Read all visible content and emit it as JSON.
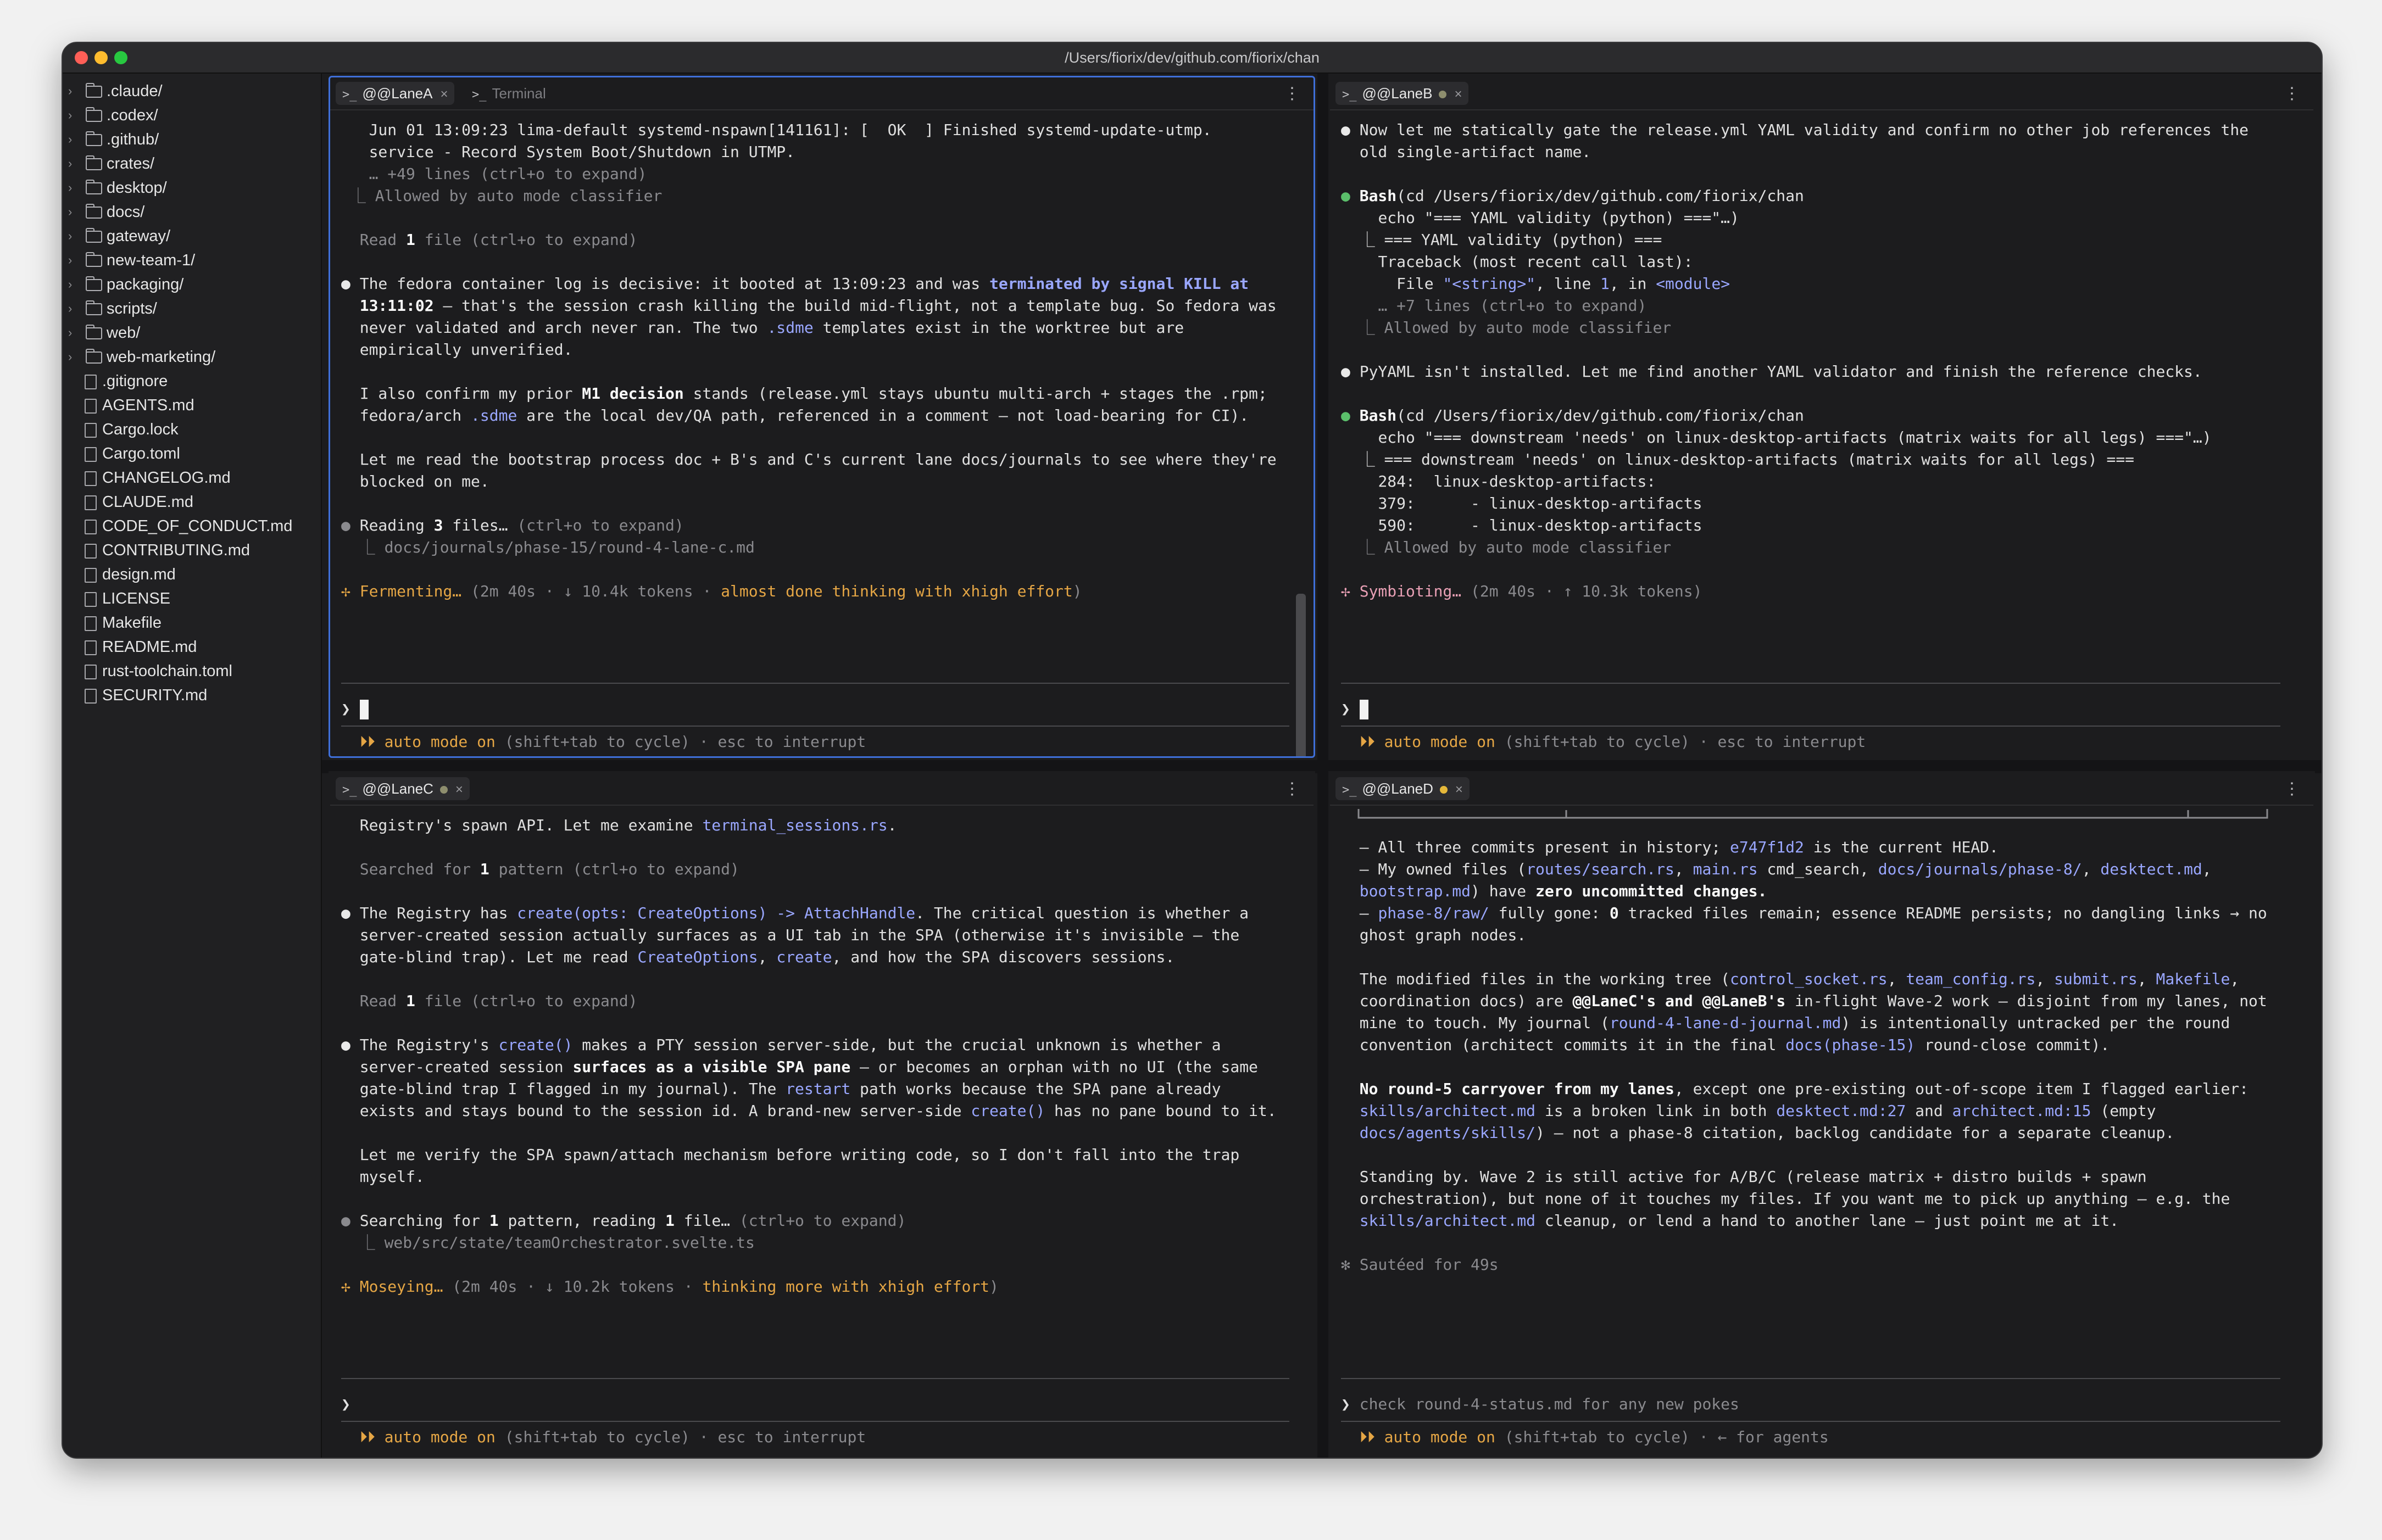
{
  "window": {
    "title": "/Users/fiorix/dev/github.com/fiorix/chan"
  },
  "sidebar": {
    "folders": [
      ".claude/",
      ".codex/",
      ".github/",
      "crates/",
      "desktop/",
      "docs/",
      "gateway/",
      "new-team-1/",
      "packaging/",
      "scripts/",
      "web/",
      "web-marketing/"
    ],
    "files": [
      ".gitignore",
      "AGENTS.md",
      "Cargo.lock",
      "Cargo.toml",
      "CHANGELOG.md",
      "CLAUDE.md",
      "CODE_OF_CONDUCT.md",
      "CONTRIBUTING.md",
      "design.md",
      "LICENSE",
      "Makefile",
      "README.md",
      "rust-toolchain.toml",
      "SECURITY.md"
    ]
  },
  "panes": {
    "top_left": {
      "tabs": [
        {
          "label": "@@LaneA",
          "close": "×"
        },
        {
          "label": "Terminal"
        }
      ],
      "lines": {
        "l1": "Jun 01 13:09:23 lima-default systemd-nspawn[141161]: [  OK  ] Finished systemd-update-utmp.",
        "l2": "service - Record System Boot/Shutdown in UTMP.",
        "l3": "… +49 lines (ctrl+o to expand)",
        "l4": "Allowed by auto mode classifier",
        "l5a": "Read ",
        "l5b": "1",
        "l5c": " file (ctrl+o to expand)",
        "p1a": "The fedora container log is decisive: it booted at 13:09:23 and was ",
        "p1b": "terminated by signal KILL at",
        "p1c": "13:11:02",
        "p1d": " — that's the session crash killing the build mid-flight, not a template bug. So fedora was",
        "p1e": "never validated and arch never ran. The two ",
        "p1f": ".sdme",
        "p1g": " templates exist in the worktree but are",
        "p1h": "empirically unverified.",
        "p2a": "I also confirm my prior ",
        "p2b": "M1 decision",
        "p2c": " stands (release.yml stays ubuntu multi-arch + stages the .rpm;",
        "p2d": "fedora/arch ",
        "p2e": ".sdme",
        "p2f": " are the local dev/QA path, referenced in a comment — not load-bearing for CI).",
        "p3a": "Let me read the bootstrap process doc + B's and C's current lane docs/journals to see where they're",
        "p3b": "blocked on me.",
        "r1a": "Reading ",
        "r1b": "3",
        "r1c": " files… ",
        "r1d": "(ctrl+o to expand)",
        "r2": "docs/journals/phase-15/round-4-lane-c.md",
        "s1": "✢ Fermenting… ",
        "s2": "(2m 40s · ↓ 10.4k tokens · ",
        "s3": "almost done thinking with xhigh effort",
        "s4": ")",
        "prompt": "❯",
        "f1": "⏵⏵ auto mode on",
        "f2": " (shift+tab to cycle) · esc to interrupt"
      }
    },
    "top_right": {
      "tabs": [
        {
          "label": "@@LaneB",
          "close": "×"
        }
      ],
      "lines": {
        "a1": "Now let me statically gate the release.yml YAML validity and confirm no other job references the",
        "a2": "old single-artifact name.",
        "b1a": "Bash",
        "b1b": "(cd /Users/fiorix/dev/github.com/fiorix/chan",
        "b2": "echo \"=== YAML validity (python) ===\"…)",
        "b3": "=== YAML validity (python) ===",
        "b4": "Traceback (most recent call last):",
        "b5a": "File ",
        "b5b": "\"<string>\"",
        "b5c": ", line ",
        "b5d": "1",
        "b5e": ", in ",
        "b5f": "<module>",
        "b6": "… +7 lines (ctrl+o to expand)",
        "b7": "Allowed by auto mode classifier",
        "c1": "PyYAML isn't installed. Let me find another YAML validator and finish the reference checks.",
        "d1a": "Bash",
        "d1b": "(cd /Users/fiorix/dev/github.com/fiorix/chan",
        "d2": "echo \"=== downstream 'needs' on linux-desktop-artifacts (matrix waits for all legs) ===\"…)",
        "d3": "=== downstream 'needs' on linux-desktop-artifacts (matrix waits for all legs) ===",
        "d4": "284:  linux-desktop-artifacts:",
        "d5": "379:      - linux-desktop-artifacts",
        "d6": "590:      - linux-desktop-artifacts",
        "d7": "Allowed by auto mode classifier",
        "s1": "✢ Symbioting… ",
        "s2": "(2m 40s · ↑ 10.3k tokens)",
        "prompt": "❯",
        "f1": "⏵⏵ auto mode on",
        "f2": " (shift+tab to cycle) · esc to interrupt"
      }
    },
    "bottom_left": {
      "tabs": [
        {
          "label": "@@LaneC",
          "close": "×"
        }
      ],
      "lines": {
        "a1a": "Registry's spawn API. Let me examine ",
        "a1b": "terminal_sessions.rs",
        "a1c": ".",
        "a2a": "Searched for ",
        "a2b": "1",
        "a2c": " pattern (ctrl+o to expand)",
        "p1a": "The Registry has ",
        "p1b": "create(opts: CreateOptions) -> AttachHandle",
        "p1c": ". The critical question is whether a",
        "p1d": "server-created session actually surfaces as a UI tab in the SPA (otherwise it's invisible — the",
        "p1e": "gate-blind trap). Let me read ",
        "p1f": "CreateOptions",
        "p1g": ", ",
        "p1h": "create",
        "p1i": ", and how the SPA discovers sessions.",
        "a3a": "Read ",
        "a3b": "1",
        "a3c": " file (ctrl+o to expand)",
        "p2a": "The Registry's ",
        "p2b": "create()",
        "p2c": " makes a PTY session server-side, but the crucial unknown is whether a",
        "p2d": "server-created session ",
        "p2e": "surfaces as a visible SPA pane",
        "p2f": " — or becomes an orphan with no UI (the same",
        "p2g": "gate-blind trap I flagged in my journal). The ",
        "p2h": "restart",
        "p2i": " path works because the SPA pane already",
        "p2j": "exists and stays bound to the session id. A brand-new server-side ",
        "p2k": "create()",
        "p2l": " has no pane bound to it.",
        "p3a": "Let me verify the SPA spawn/attach mechanism before writing code, so I don't fall into the trap",
        "p3b": "myself.",
        "r1a": "Searching for ",
        "r1b": "1",
        "r1c": " pattern, reading ",
        "r1d": "1",
        "r1e": " file… ",
        "r1f": "(ctrl+o to expand)",
        "r2": "web/src/state/teamOrchestrator.svelte.ts",
        "s1": "✢ Moseying… ",
        "s2": "(2m 40s · ↓ 10.2k tokens · ",
        "s3": "thinking more with xhigh effort",
        "s4": ")",
        "prompt": "❯",
        "f1": "⏵⏵ auto mode on",
        "f2": " (shift+tab to cycle) · esc to interrupt"
      }
    },
    "bottom_right": {
      "tabs": [
        {
          "label": "@@LaneD",
          "close": "×"
        }
      ],
      "lines": {
        "l1a": "– All three commits present in history; ",
        "l1b": "e747f1d2",
        "l1c": " is the current HEAD.",
        "l2a": "– My owned files (",
        "l2b": "routes/search.rs",
        "l2c": ", ",
        "l2d": "main.rs",
        "l2e": " cmd_search, ",
        "l2f": "docs/journals/phase-8/",
        "l2g": ", ",
        "l2h": "desktect.md",
        "l2i": ",",
        "l3a": "bootstrap.md",
        "l3b": ") have ",
        "l3c": "zero uncommitted changes.",
        "l4a": "– ",
        "l4b": "phase-8/raw/",
        "l4c": " fully gone: ",
        "l4d": "0",
        "l4e": " tracked files remain; essence README persists; no dangling links → no",
        "l5": "ghost graph nodes.",
        "m1a": "The modified files in the working tree (",
        "m1b": "control_socket.rs",
        "m1c": ", ",
        "m1d": "team_config.rs",
        "m1e": ", ",
        "m1f": "submit.rs",
        "m1g": ", ",
        "m1h": "Makefile",
        "m1i": ",",
        "m2a": "coordination docs) are ",
        "m2b": "@@LaneC's and @@LaneB's",
        "m2c": " in-flight Wave-2 work — disjoint from my lanes, not",
        "m3a": "mine to touch. My journal (",
        "m3b": "round-4-lane-d-journal.md",
        "m3c": ") is intentionally untracked per the round",
        "m4a": "convention (architect commits it in the final ",
        "m4b": "docs(phase-15)",
        "m4c": " round-close commit).",
        "n1a": "No round-5 carryover from my lanes",
        "n1b": ", except one pre-existing out-of-scope item I flagged earlier:",
        "n2a": "skills/architect.md",
        "n2b": " is a broken link in both ",
        "n2c": "desktect.md:27",
        "n2d": " and ",
        "n2e": "architect.md:15",
        "n2f": " (empty",
        "n3a": "docs/agents/skills/",
        "n3b": ") — not a phase-8 citation, backlog candidate for a separate cleanup.",
        "o1": "Standing by. Wave 2 is still active for A/B/C (release matrix + distro builds + spawn",
        "o2": "orchestration), but none of it touches my files. If you want me to pick up anything — e.g. the",
        "o3a": "skills/architect.md",
        "o3b": " cleanup, or lend a hand to another lane — just point me at it.",
        "s1": "✻ Sautéed for 49s",
        "prompt": "❯",
        "input": "check round-4-status.md for any new pokes",
        "f1": "⏵⏵ auto mode on",
        "f2": " (shift+tab to cycle) · ← for agents"
      }
    }
  },
  "colors": {
    "accent": "#3f6fd8",
    "link": "#9aa7ff",
    "status": "#e5a645",
    "ok": "#5bbf6b",
    "dot_gray": "#8e8e6e",
    "dot_yellow": "#e5b83a"
  }
}
